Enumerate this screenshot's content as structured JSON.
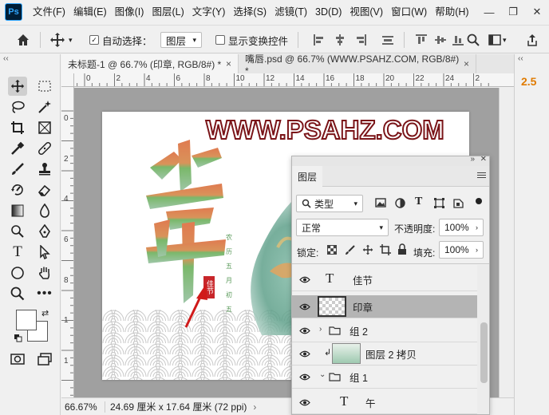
{
  "menubar": {
    "logo": "Ps",
    "items": [
      "文件(F)",
      "编辑(E)",
      "图像(I)",
      "图层(L)",
      "文字(Y)",
      "选择(S)",
      "滤镜(T)",
      "3D(D)",
      "视图(V)",
      "窗口(W)",
      "帮助(H)"
    ]
  },
  "options": {
    "auto_select_label": "自动选择：",
    "auto_select_target": "图层",
    "show_transform_label": "显示变换控件"
  },
  "tabs": [
    {
      "label": "未标题-1 @ 66.7% (印章, RGB/8#) *",
      "close": "×"
    },
    {
      "label": "嘴唇.psd @ 66.7% (WWW.PSAHZ.COM, RGB/8#) *",
      "close": "×"
    }
  ],
  "rulers": {
    "h": [
      "2",
      "0",
      "2",
      "4",
      "6",
      "8",
      "10",
      "12",
      "14",
      "16",
      "18",
      "20",
      "22",
      "24",
      "2"
    ],
    "v": [
      "0",
      "2",
      "4",
      "6",
      "8",
      "1",
      "1"
    ]
  },
  "canvas": {
    "watermark": "WWW.PSAHZ.COM",
    "vertical_text": [
      "农",
      "历",
      "五",
      "月",
      "初",
      "五"
    ],
    "seal_text": "佳节"
  },
  "status": {
    "zoom": "66.67%",
    "doc_size": "24.69 厘米 x 17.64 厘米 (72 ppi)",
    "arrow": "›"
  },
  "right_dock": {
    "value": "2.5"
  },
  "layers_panel": {
    "title": "图层",
    "filter_kind": "类型",
    "blend_mode": "正常",
    "opacity_label": "不透明度:",
    "opacity_value": "100%",
    "lock_label": "锁定:",
    "fill_label": "填充:",
    "fill_value": "100%",
    "rows": [
      {
        "name": "佳节",
        "kind": "text"
      },
      {
        "name": "印章",
        "kind": "pixel",
        "selected": true
      },
      {
        "name": "组 2",
        "kind": "group"
      },
      {
        "name": "图层 2 拷贝",
        "kind": "pixel"
      },
      {
        "name": "组 1",
        "kind": "group"
      },
      {
        "name": "午",
        "kind": "text"
      }
    ]
  },
  "colors": {
    "watermark_fill": "#ffffff",
    "watermark_stroke": "#7a1418",
    "selected_row": "#b4b4b4",
    "accent": "#e07b00"
  }
}
